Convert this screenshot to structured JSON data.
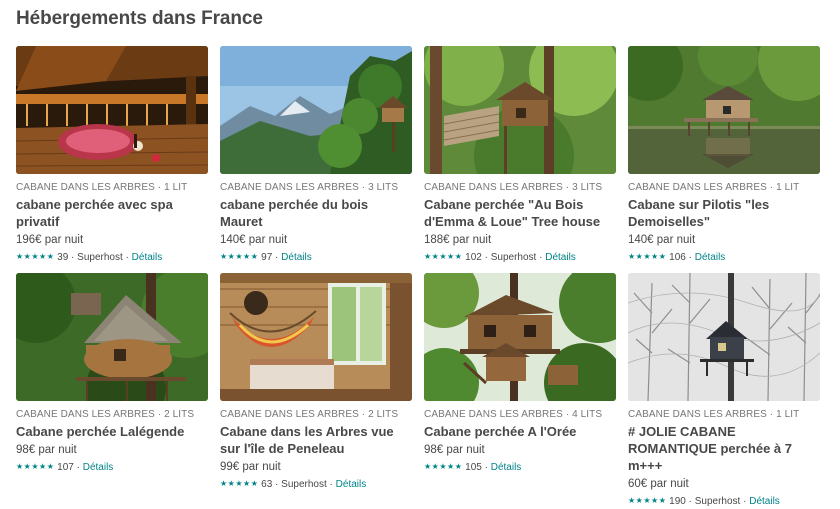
{
  "section": {
    "title": "Hébergements dans France"
  },
  "colors": {
    "accent": "#008489",
    "text": "#484848",
    "muted": "#767676"
  },
  "listings": [
    {
      "kicker": "CABANE DANS LES ARBRES · 1 LIT",
      "title": "cabane perchée avec spa privatif",
      "price": "196€ par nuit",
      "stars": "★★★★★",
      "reviews": "39",
      "superhost": "Superhost",
      "details": "Détails",
      "image": "night-spa-deck"
    },
    {
      "kicker": "CABANE DANS LES ARBRES · 3 LITS",
      "title": "cabane perchée du bois Mauret",
      "price": "140€ par nuit",
      "stars": "★★★★★",
      "reviews": "97",
      "superhost": "",
      "details": "Détails",
      "image": "mountain-view"
    },
    {
      "kicker": "CABANE DANS LES ARBRES · 3 LITS",
      "title": "Cabane perchée \"Au Bois d'Emma & Loue\" Tree house",
      "price": "188€ par nuit",
      "stars": "★★★★★",
      "reviews": "102",
      "superhost": "Superhost",
      "details": "Détails",
      "image": "forest-bridge"
    },
    {
      "kicker": "CABANE DANS LES ARBRES · 1 LIT",
      "title": "Cabane sur Pilotis \"les Demoiselles\"",
      "price": "140€ par nuit",
      "stars": "★★★★★",
      "reviews": "106",
      "superhost": "",
      "details": "Détails",
      "image": "lake-stilts"
    },
    {
      "kicker": "CABANE DANS LES ARBRES · 2 LITS",
      "title": "Cabane perchée Lalégende",
      "price": "98€ par nuit",
      "stars": "★★★★★",
      "reviews": "107",
      "superhost": "",
      "details": "Détails",
      "image": "round-treehouse"
    },
    {
      "kicker": "CABANE DANS LES ARBRES · 2 LITS",
      "title": "Cabane dans les Arbres vue sur l'île de Peneleau",
      "price": "99€ par nuit",
      "stars": "★★★★★",
      "reviews": "63",
      "superhost": "Superhost",
      "details": "Détails",
      "image": "interior-hammock"
    },
    {
      "kicker": "CABANE DANS LES ARBRES · 4 LITS",
      "title": "Cabane perchée A l'Orée",
      "price": "98€ par nuit",
      "stars": "★★★★★",
      "reviews": "105",
      "superhost": "",
      "details": "Détails",
      "image": "tall-treehouse"
    },
    {
      "kicker": "CABANE DANS LES ARBRES · 1 LIT",
      "title": "# JOLIE CABANE ROMANTIQUE perchée à 7 m+++",
      "price": "60€ par nuit",
      "stars": "★★★★★",
      "reviews": "190",
      "superhost": "Superhost",
      "details": "Détails",
      "image": "snow-forest"
    }
  ]
}
